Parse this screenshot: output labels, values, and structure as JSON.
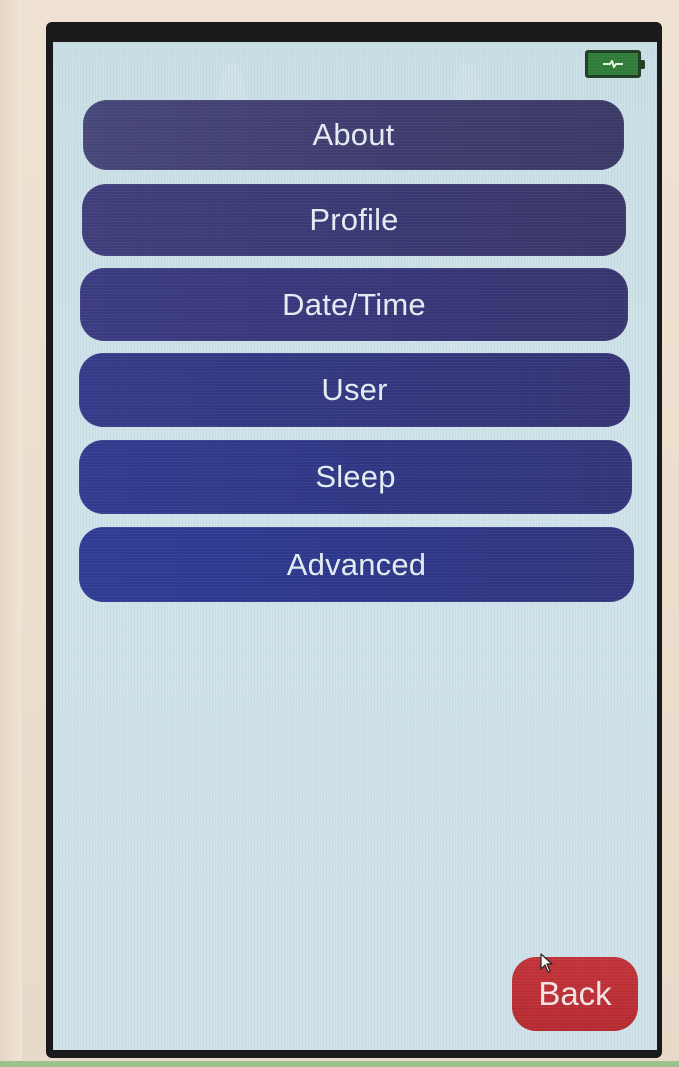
{
  "status": {
    "battery_icon": "battery-charging-icon",
    "battery_color": "#2f7d39"
  },
  "menu": {
    "items": [
      {
        "label": "About"
      },
      {
        "label": "Profile"
      },
      {
        "label": "Date/Time"
      },
      {
        "label": "User"
      },
      {
        "label": "Sleep"
      },
      {
        "label": "Advanced"
      }
    ],
    "button_color": "#33377f"
  },
  "footer": {
    "back_label": "Back",
    "back_color": "#c3333a"
  },
  "pointer": {
    "icon": "mouse-pointer-icon"
  }
}
